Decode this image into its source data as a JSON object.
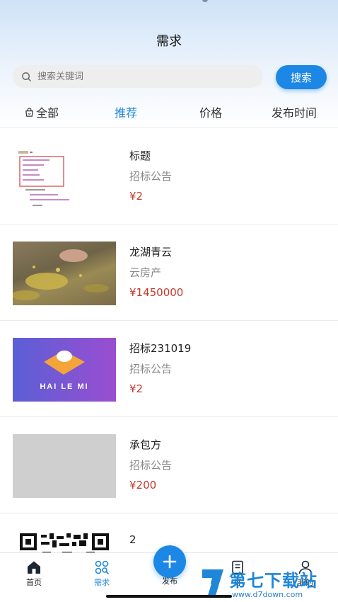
{
  "header": {
    "title": "需求"
  },
  "search": {
    "placeholder": "搜索关键词",
    "button_label": "搜索"
  },
  "tabs": [
    {
      "label": "全部"
    },
    {
      "label": "推荐"
    },
    {
      "label": "价格"
    },
    {
      "label": "发布时间"
    }
  ],
  "active_tab": "推荐",
  "items": [
    {
      "title": "标题",
      "subtitle": "招标公告",
      "price": "¥2"
    },
    {
      "title": "龙湖青云",
      "subtitle": "云房产",
      "price": "¥1450000"
    },
    {
      "title": "招标231019",
      "subtitle": "招标公告",
      "price": "¥2",
      "thumb_text": "HAI LE MI"
    },
    {
      "title": "承包方",
      "subtitle": "招标公告",
      "price": "¥200"
    },
    {
      "title": "2"
    }
  ],
  "bottom_nav": {
    "home": "首页",
    "demand": "需求",
    "publish": "发布",
    "orders": "订",
    "mine": "我的"
  },
  "watermark": {
    "text": "第七下载站",
    "url": "www.d7down.com"
  },
  "colors": {
    "accent": "#1d87e6",
    "price": "#c0392b"
  }
}
